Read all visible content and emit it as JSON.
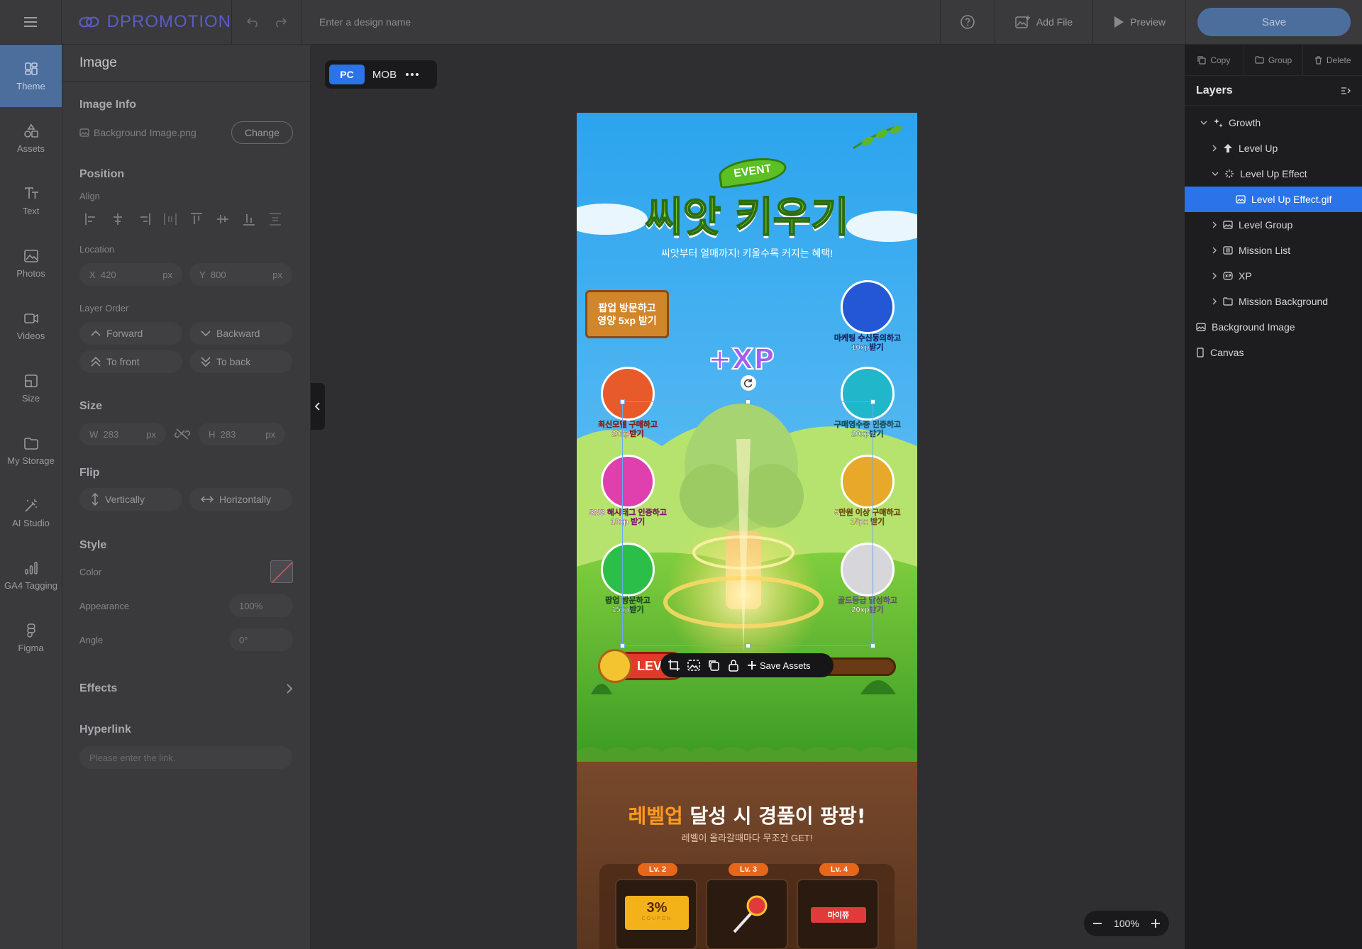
{
  "topbar": {
    "logo_text": "DPROMOTION",
    "design_name_placeholder": "Enter a design name",
    "add_file": "Add File",
    "preview": "Preview",
    "save": "Save"
  },
  "left_nav": [
    {
      "label": "Theme",
      "icon": "theme-icon"
    },
    {
      "label": "Assets",
      "icon": "assets-icon"
    },
    {
      "label": "Text",
      "icon": "text-icon"
    },
    {
      "label": "Photos",
      "icon": "photos-icon"
    },
    {
      "label": "Videos",
      "icon": "videos-icon"
    },
    {
      "label": "Size",
      "icon": "size-icon"
    },
    {
      "label": "My Storage",
      "icon": "folder-icon"
    },
    {
      "label": "AI Studio",
      "icon": "magic-wand-icon"
    },
    {
      "label": "GA4 Tagging",
      "icon": "analytics-icon"
    },
    {
      "label": "Figma",
      "icon": "figma-icon"
    }
  ],
  "panel": {
    "title": "Image",
    "image_info": {
      "title": "Image Info",
      "file": "Background Image.png",
      "change": "Change"
    },
    "position": {
      "title": "Position",
      "align": "Align",
      "location": "Location",
      "x_label": "X",
      "x_value": "420",
      "x_unit": "px",
      "y_label": "Y",
      "y_value": "800",
      "y_unit": "px",
      "layer_order": "Layer Order",
      "forward": "Forward",
      "backward": "Backward",
      "to_front": "To front",
      "to_back": "To back"
    },
    "size": {
      "title": "Size",
      "w_label": "W",
      "w_value": "283",
      "h_label": "H",
      "h_value": "283",
      "unit": "px"
    },
    "flip": {
      "title": "Flip",
      "vertically": "Vertically",
      "horizontally": "Horizontally"
    },
    "style": {
      "title": "Style",
      "color": "Color",
      "appearance": "Appearance",
      "appearance_value": "100%",
      "angle": "Angle",
      "angle_value": "0°"
    },
    "effects": "Effects",
    "hyperlink": {
      "title": "Hyperlink",
      "placeholder": "Please enter the link."
    }
  },
  "canvas": {
    "device_pc": "PC",
    "device_mob": "MOB",
    "zoom": "100%",
    "toolbar_save_assets": "Save Assets"
  },
  "artboard": {
    "event_badge": "EVENT",
    "title": "씨앗 키우기",
    "subtitle": "씨앗부터 열매까지! 키울수록 커지는 혜택!",
    "popup_card": "팝업 방문하고\n영양 5xp 받기",
    "xp_badge": "+XP",
    "missions_left": [
      {
        "label": "최신모델 구매하고\n20xp받기",
        "color": "#e85a2a"
      },
      {
        "label": "SNS 해시태그 인증하고\n10xp 받기",
        "color": "#e03fae"
      },
      {
        "label": "팝업 방문하고\n15xp받기",
        "color": "#2bbf4a"
      }
    ],
    "missions_right": [
      {
        "label": "마케팅 수신동의하고\n10xp받기",
        "color": "#2457d6"
      },
      {
        "label": "구매영수증 인증하고\n20xp받기",
        "color": "#1fb7c9"
      },
      {
        "label": "5만원 이상 구매하고\n15px 받기",
        "color": "#e8a92a"
      },
      {
        "label": "골드등급 달성하고\n20xp받기",
        "color": "#d7d7db"
      }
    ],
    "level_label": "LEV",
    "reward_title_highlight": "레벨업",
    "reward_title_rest": " 달성 시 경품이 팡팡!",
    "reward_subtitle": "레벨이 올라갈때마다 무조건 GET!",
    "rewards": [
      {
        "level": "Lv. 2",
        "item": "3%",
        "caption": "COUPON"
      },
      {
        "level": "Lv. 3",
        "item": ""
      },
      {
        "level": "Lv. 4",
        "item": "마이쮸"
      }
    ]
  },
  "right_panel": {
    "copy": "Copy",
    "group": "Group",
    "delete": "Delete",
    "layers_title": "Layers",
    "layers": [
      {
        "label": "Growth",
        "icon": "sparkle-icon"
      },
      {
        "label": "Level Up",
        "icon": "arrow-up-icon"
      },
      {
        "label": "Level Up Effect",
        "icon": "loading-icon"
      },
      {
        "label": "Level Up Effect.gif",
        "icon": "image-icon"
      },
      {
        "label": "Level Group",
        "icon": "image-icon"
      },
      {
        "label": "Mission List",
        "icon": "list-icon"
      },
      {
        "label": "XP",
        "icon": "xp-icon"
      },
      {
        "label": "Mission Background",
        "icon": "folder-icon"
      },
      {
        "label": "Background Image",
        "icon": "image-icon"
      },
      {
        "label": "Canvas",
        "icon": "canvas-icon"
      }
    ]
  }
}
